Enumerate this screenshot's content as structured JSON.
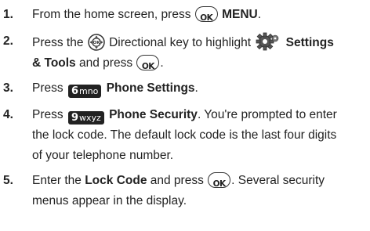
{
  "steps": [
    {
      "num": "1.",
      "text_a": "From the home screen, press",
      "bold_a": "MENU",
      "text_b": "."
    },
    {
      "num": "2.",
      "text_a": "Press the",
      "text_b": "Directional key to highlight",
      "bold_a": "Settings",
      "bold_b": "& Tools",
      "text_c": "and press",
      "text_d": "."
    },
    {
      "num": "3.",
      "text_a": "Press",
      "key_digit": "6",
      "key_letters": "mno",
      "bold_a": "Phone Settings",
      "text_b": "."
    },
    {
      "num": "4.",
      "text_a": "Press",
      "key_digit": "9",
      "key_letters": "wxyz",
      "bold_a": "Phone Security",
      "text_b": ". You're prompted to enter",
      "line2": "the lock code. The default lock code is the last four digits",
      "line3": "of your telephone number."
    },
    {
      "num": "5.",
      "text_a": "Enter the",
      "bold_a": "Lock Code",
      "text_b": "and press",
      "text_c": ". Several security",
      "line2": "menus appear in the display."
    }
  ],
  "icons": {
    "ok": "ok-key-icon",
    "directional": "directional-key-icon",
    "settings": "settings-gear-icon"
  }
}
